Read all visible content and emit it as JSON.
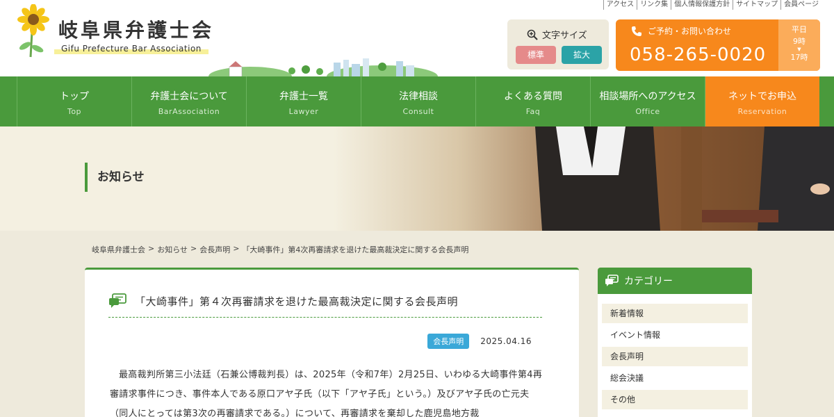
{
  "header": {
    "toplinks": [
      "アクセス",
      "リンク集",
      "個人情報保護方針",
      "サイトマップ",
      "会員ページ"
    ],
    "logo_title": "岐阜県弁護士会",
    "logo_sub": "Gifu Prefecture Bar Association",
    "fontsize_label": "文字サイズ",
    "fontsize_std": "標準",
    "fontsize_big": "拡大",
    "contact_label": "ご予約・お問い合わせ",
    "contact_phone": "058-265-0020",
    "hours_day": "平日",
    "hours_start": "9時",
    "hours_end": "17時"
  },
  "nav": [
    {
      "jp": "トップ",
      "en": "Top"
    },
    {
      "jp": "弁護士会について",
      "en": "BarAssociation"
    },
    {
      "jp": "弁護士一覧",
      "en": "Lawyer"
    },
    {
      "jp": "法律相談",
      "en": "Consult"
    },
    {
      "jp": "よくある質問",
      "en": "Faq"
    },
    {
      "jp": "相談場所へのアクセス",
      "en": "Office"
    },
    {
      "jp": "ネットでお申込",
      "en": "Reservation"
    }
  ],
  "banner": {
    "title": "お知らせ"
  },
  "breadcrumb": [
    "岐阜県弁護士会",
    "お知らせ",
    "会長声明",
    "「大崎事件」第4次再審請求を退けた最高裁決定に関する会長声明"
  ],
  "breadcrumb_sep": ">",
  "article": {
    "title": "「大崎事件」第４次再審請求を退けた最高裁決定に関する会長声明",
    "category": "会長声明",
    "date": "2025.04.16",
    "body": "最高裁判所第三小法廷（石兼公博裁判長）は、2025年（令和7年）2月25日、いわゆる大崎事件第4再審請求事件につき、事件本人である原口アヤ子氏（以下「アヤ子氏」という。）及びアヤ子氏の亡元夫（同人にとっては第3次の再審請求である。）について、再審請求を棄却した鹿児島地方裁"
  },
  "sidebar": {
    "title": "カテゴリー",
    "items": [
      "新着情報",
      "イベント情報",
      "会長声明",
      "総会決議",
      "その他"
    ]
  },
  "colors": {
    "green": "#4a9a3c",
    "orange": "#f7881c",
    "pink": "#e58a8a",
    "teal": "#2ba3a7",
    "badge": "#3aa8d8"
  }
}
